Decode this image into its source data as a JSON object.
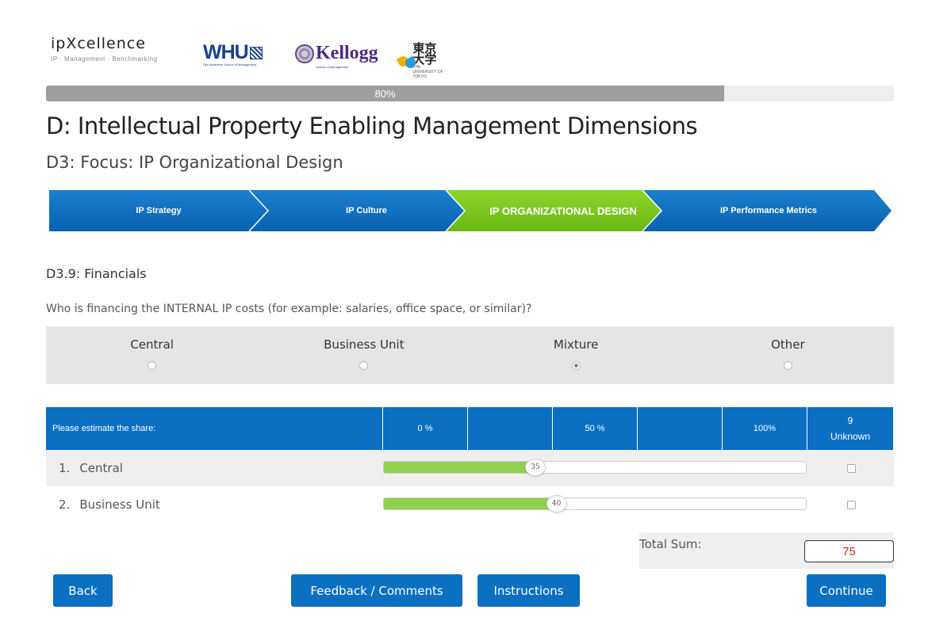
{
  "logos": {
    "ipx_name": "ipXcellence",
    "ipx_sub": "IP · Management · Benchmarking",
    "whu": "WHU",
    "whu_tag": "Otto Beisheim School of Management",
    "kellogg": "Kellogg",
    "kellogg_sub": "School of Management",
    "tokyo_kanji": "東京大学",
    "tokyo_eng": "THE UNIVERSITY OF TOKYO"
  },
  "progress": {
    "label": "80%",
    "value": 0.8
  },
  "page_title": "D: Intellectual Property Enabling Management Dimensions",
  "section_title": "D3: Focus: IP Organizational Design",
  "steps": [
    {
      "label": "IP Strategy",
      "active": false
    },
    {
      "label": "IP Culture",
      "active": false
    },
    {
      "label": "IP ORGANIZATIONAL DESIGN",
      "active": true
    },
    {
      "label": "IP Performance Metrics",
      "active": false
    }
  ],
  "colors": {
    "primary": "#0b6fc2",
    "active_step": "#7ec820",
    "slider_fill": "#8fd14f",
    "total_value": "#dd2222"
  },
  "question": {
    "title": "D3.9: Financials",
    "text": "Who is financing the INTERNAL IP costs (for example: salaries, office space, or similar)?",
    "options": [
      {
        "label": "Central",
        "selected": false
      },
      {
        "label": "Business Unit",
        "selected": false
      },
      {
        "label": "Mixture",
        "selected": true
      },
      {
        "label": "Other",
        "selected": false
      }
    ]
  },
  "share_table": {
    "header": {
      "label": "Please estimate the share:",
      "scale": [
        "0 %",
        "",
        "50 %",
        "",
        "100%"
      ],
      "unknown_code": "9",
      "unknown_label": "Unknown"
    },
    "rows": [
      {
        "number": "1.",
        "name": "Central",
        "value": 35,
        "unknown": false
      },
      {
        "number": "2.",
        "name": "Business Unit",
        "value": 40,
        "unknown": false
      }
    ]
  },
  "total": {
    "label": "Total Sum:",
    "value": "75"
  },
  "buttons": {
    "back": "Back",
    "feedback": "Feedback / Comments",
    "instructions": "Instructions",
    "continue": "Continue"
  }
}
